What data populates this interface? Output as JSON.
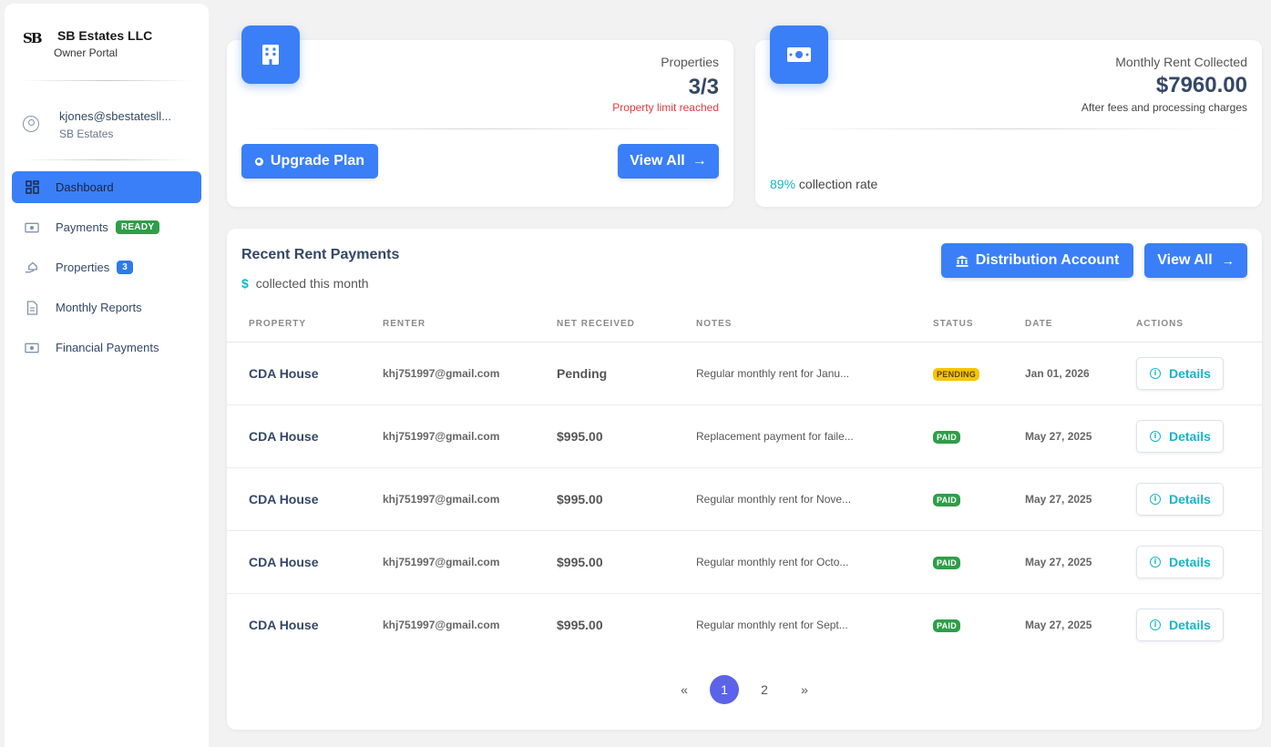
{
  "sidebar": {
    "brand_name": "SB Estates LLC",
    "brand_sub": "Owner Portal",
    "logo_text": "SB",
    "user_email": "kjones@sbestatesll...",
    "user_company": "SB Estates",
    "nav": [
      {
        "label": "Dashboard",
        "icon": "dashboard-icon",
        "active": true
      },
      {
        "label": "Payments",
        "icon": "money-icon",
        "badge": "READY"
      },
      {
        "label": "Properties",
        "icon": "house-hand-icon",
        "badge": "3"
      },
      {
        "label": "Monthly Reports",
        "icon": "document-icon"
      },
      {
        "label": "Financial Payments",
        "icon": "money-icon"
      }
    ]
  },
  "properties_card": {
    "label": "Properties",
    "value": "3/3",
    "note": "Property limit reached",
    "upgrade_label": "Upgrade Plan",
    "view_all_label": "View All"
  },
  "rent_card": {
    "label": "Monthly Rent Collected",
    "value": "$7960.00",
    "note": "After fees and processing charges",
    "rate_pct": "89%",
    "rate_text": "collection rate"
  },
  "payments": {
    "title": "Recent Rent Payments",
    "sub_symbol": "$",
    "sub_text": "collected this month",
    "distribution_label": "Distribution Account",
    "view_all_label": "View All",
    "columns": [
      "PROPERTY",
      "RENTER",
      "NET RECEIVED",
      "NOTES",
      "STATUS",
      "DATE",
      "ACTIONS"
    ],
    "rows": [
      {
        "property": "CDA House",
        "renter": "khj751997@gmail.com",
        "net": "Pending",
        "notes": "Regular monthly rent for Janu...",
        "status": "PENDING",
        "date": "Jan 01, 2026",
        "action": "Details"
      },
      {
        "property": "CDA House",
        "renter": "khj751997@gmail.com",
        "net": "$995.00",
        "notes": "Replacement payment for faile...",
        "status": "PAID",
        "date": "May 27, 2025",
        "action": "Details"
      },
      {
        "property": "CDA House",
        "renter": "khj751997@gmail.com",
        "net": "$995.00",
        "notes": "Regular monthly rent for Nove...",
        "status": "PAID",
        "date": "May 27, 2025",
        "action": "Details"
      },
      {
        "property": "CDA House",
        "renter": "khj751997@gmail.com",
        "net": "$995.00",
        "notes": "Regular monthly rent for Octo...",
        "status": "PAID",
        "date": "May 27, 2025",
        "action": "Details"
      },
      {
        "property": "CDA House",
        "renter": "khj751997@gmail.com",
        "net": "$995.00",
        "notes": "Regular monthly rent for Sept...",
        "status": "PAID",
        "date": "May 27, 2025",
        "action": "Details"
      }
    ],
    "pager": {
      "prev": "«",
      "pages": [
        "1",
        "2"
      ],
      "current": "1",
      "next": "»"
    }
  },
  "colors": {
    "primary": "#3a7ff7",
    "accent": "#17b4c9",
    "paid": "#2e9e49",
    "pending": "#f7c400",
    "danger": "#e5393d",
    "pager_active": "#5b63e8"
  }
}
